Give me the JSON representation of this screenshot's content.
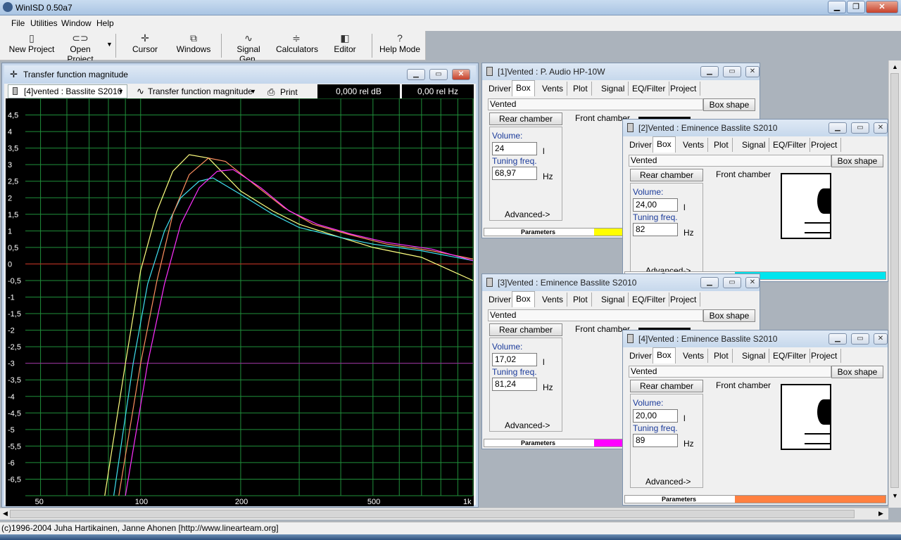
{
  "app": {
    "title": "WinISD 0.50a7"
  },
  "menu": {
    "file": "File",
    "utilities": "Utilities",
    "window": "Window",
    "help": "Help"
  },
  "toolbar": {
    "new_project": "New Project",
    "open_project": "Open Project",
    "cursor": "Cursor",
    "windows": "Windows",
    "signal_gen": "Signal Gen.",
    "calculators": "Calculators",
    "editor": "Editor",
    "help_mode": "Help Mode"
  },
  "graph_window": {
    "title": "Transfer function magnitude",
    "project_select": "[4]vented : Basslite S2010",
    "plot_select": "Transfer function magnitude",
    "print": "Print",
    "readout_db": "0,000 rel dB",
    "readout_hz": "0,00 rel Hz"
  },
  "chart_data": {
    "type": "line",
    "title": "",
    "xlabel": "",
    "ylabel": "",
    "x_scale": "log",
    "xlim": [
      45,
      1000
    ],
    "ylim": [
      -7,
      5
    ],
    "x_ticks": [
      "50",
      "100",
      "200",
      "500",
      "1k"
    ],
    "y_ticks": [
      "4,5",
      "4",
      "3,5",
      "3",
      "2,5",
      "2",
      "1,5",
      "1",
      "0,5",
      "0",
      "-0,5",
      "-1",
      "-1,5",
      "-2",
      "-2,5",
      "-3",
      "-3,5",
      "-4",
      "-4,5",
      "-5",
      "-5,5",
      "-6",
      "-6,5"
    ],
    "grid": true,
    "reference_lines": [
      {
        "y": 0,
        "color": "#d02020"
      },
      {
        "y": -3,
        "color": "#a020a0"
      }
    ],
    "series": [
      {
        "color": "#ffff80",
        "x": [
          78,
          90,
          100,
          112,
          125,
          140,
          160,
          200,
          250,
          300,
          400,
          500,
          700,
          1000
        ],
        "y": [
          -7,
          -3,
          -0.2,
          1.6,
          2.8,
          3.3,
          3.2,
          2.2,
          1.6,
          1.2,
          0.8,
          0.5,
          0.2,
          -0.5
        ]
      },
      {
        "color": "#40e0f0",
        "x": [
          83,
          95,
          105,
          118,
          132,
          150,
          165,
          200,
          250,
          300,
          400,
          500,
          700,
          1000
        ],
        "y": [
          -7,
          -3,
          -0.6,
          1.0,
          2.0,
          2.5,
          2.6,
          2.1,
          1.5,
          1.1,
          0.8,
          0.6,
          0.4,
          0.1
        ]
      },
      {
        "color": "#ff9060",
        "x": [
          86,
          100,
          112,
          125,
          140,
          160,
          180,
          220,
          270,
          330,
          420,
          550,
          750,
          1000
        ],
        "y": [
          -7,
          -3,
          -0.5,
          1.5,
          2.7,
          3.2,
          3.1,
          2.4,
          1.7,
          1.2,
          0.9,
          0.6,
          0.4,
          0.15
        ]
      },
      {
        "color": "#ff30ff",
        "x": [
          90,
          105,
          118,
          132,
          150,
          170,
          190,
          230,
          280,
          340,
          430,
          550,
          750,
          1000
        ],
        "y": [
          -7,
          -3,
          -0.6,
          1.2,
          2.3,
          2.8,
          2.85,
          2.3,
          1.6,
          1.2,
          0.9,
          0.65,
          0.45,
          0.1
        ]
      }
    ]
  },
  "windows": [
    {
      "title": "[1]Vented : P. Audio HP-10W",
      "volume": "24",
      "tuning": "68,97",
      "params_color": "#ffff00"
    },
    {
      "title": "[2]Vented : Eminence Basslite S2010",
      "volume": "24,00",
      "tuning": "82",
      "params_color": "#00e5ee"
    },
    {
      "title": "[3]Vented : Eminence Basslite S2010",
      "volume": "17,02",
      "tuning": "81,24",
      "params_color": "#ff00ff"
    },
    {
      "title": "[4]Vented : Eminence Basslite S2010",
      "volume": "20,00",
      "tuning": "89",
      "params_color": "#ff8040"
    }
  ],
  "pw": {
    "tabs": [
      "Driver",
      "Box",
      "Vents",
      "Plot",
      "Signal",
      "EQ/Filter",
      "Project"
    ],
    "box_type": "Vented",
    "box_shape": "Box shape",
    "rear_chamber": "Rear chamber",
    "front_chamber": "Front chamber",
    "volume_label": "Volume:",
    "volume_unit": "l",
    "tuning_label": "Tuning freq.",
    "tuning_unit": "Hz",
    "advanced": "Advanced->",
    "parameters": "Parameters"
  },
  "status": {
    "text": "(c)1996-2004 Juha Hartikainen, Janne Ahonen [http://www.linearteam.org]"
  }
}
